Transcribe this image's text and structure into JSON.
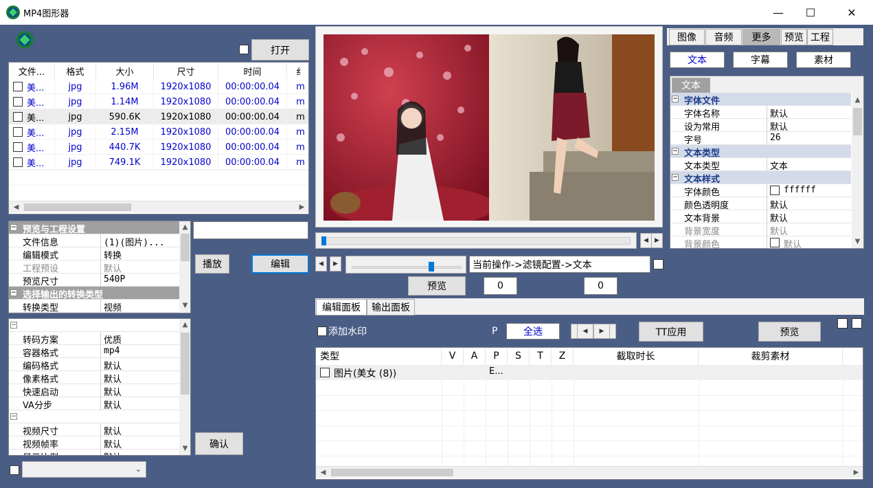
{
  "window": {
    "title": "MP4图形器",
    "minimize": "—",
    "maximize": "☐",
    "close": "✕"
  },
  "left": {
    "open_label": "打开",
    "files": {
      "headers": [
        "文件...",
        "格式",
        "大小",
        "尺寸",
        "时间",
        "纟"
      ],
      "rows": [
        {
          "name": "美...",
          "fmt": "jpg",
          "size": "1.96M",
          "dim": "1920x1080",
          "time": "00:00:00.04",
          "more": "m",
          "sel": false
        },
        {
          "name": "美...",
          "fmt": "jpg",
          "size": "1.14M",
          "dim": "1920x1080",
          "time": "00:00:00.04",
          "more": "m",
          "sel": false
        },
        {
          "name": "美...",
          "fmt": "jpg",
          "size": "590.6K",
          "dim": "1920x1080",
          "time": "00:00:00.04",
          "more": "m",
          "sel": true
        },
        {
          "name": "美...",
          "fmt": "jpg",
          "size": "2.15M",
          "dim": "1920x1080",
          "time": "00:00:00.04",
          "more": "m",
          "sel": false
        },
        {
          "name": "美...",
          "fmt": "jpg",
          "size": "440.7K",
          "dim": "1920x1080",
          "time": "00:00:00.04",
          "more": "m",
          "sel": false
        },
        {
          "name": "美...",
          "fmt": "jpg",
          "size": "749.1K",
          "dim": "1920x1080",
          "time": "00:00:00.04",
          "more": "m",
          "sel": false
        }
      ]
    },
    "preview_settings": {
      "cat1": "预览与工程设置",
      "items1": [
        {
          "k": "文件信息",
          "v": "(1)(图片)...",
          "gray": false
        },
        {
          "k": "编辑模式",
          "v": "转换",
          "gray": false
        },
        {
          "k": "工程预设",
          "v": "默认",
          "gray": true
        },
        {
          "k": "预览尺寸",
          "v": "540P",
          "gray": false
        }
      ],
      "cat2": "选择输出的转换类型",
      "items2": [
        {
          "k": "转换类型",
          "v": "视频"
        }
      ]
    },
    "play_label": "播放",
    "edit_label": "编辑",
    "output_settings": {
      "items1": [
        {
          "k": "转码方案",
          "v": "优质"
        },
        {
          "k": "容器格式",
          "v": "mp4"
        },
        {
          "k": "编码格式",
          "v": "默认"
        },
        {
          "k": "像素格式",
          "v": "默认"
        },
        {
          "k": "快速启动",
          "v": "默认"
        },
        {
          "k": "VA分步",
          "v": "默认"
        }
      ],
      "items2": [
        {
          "k": "视频尺寸",
          "v": "默认"
        },
        {
          "k": "视频帧率",
          "v": "默认"
        },
        {
          "k": "显示比例",
          "v": "默认"
        }
      ]
    },
    "confirm_label": "确认"
  },
  "center": {
    "operation_text": "当前操作->滤镜配置->文本",
    "preview_label": "预览",
    "num1": "0",
    "num2": "0",
    "tabs": [
      "编辑面板",
      "输出面板"
    ],
    "watermark_label": "添加水印",
    "p_label": "P",
    "select_all": "全选",
    "tt_apply": "TT应用",
    "preview2": "预览",
    "table": {
      "headers": [
        "类型",
        "V",
        "A",
        "P",
        "S",
        "T",
        "Z",
        "截取时长",
        "裁剪素材"
      ],
      "row": {
        "type": "图片(美女 (8))",
        "p": "E..."
      }
    }
  },
  "right": {
    "tabs": [
      "图像",
      "音频",
      "更多",
      "预览",
      "工程"
    ],
    "subtabs": [
      "文本",
      "字幕",
      "素材"
    ],
    "text_tab": "文本",
    "props": [
      {
        "cat": "字体文件"
      },
      {
        "k": "字体名称",
        "v": "默认"
      },
      {
        "k": "设为常用",
        "v": "默认"
      },
      {
        "k": "字号",
        "v": "26"
      },
      {
        "cat": "文本类型"
      },
      {
        "k": "文本类型",
        "v": "文本"
      },
      {
        "cat": "文本样式"
      },
      {
        "k": "字体颜色",
        "v": "ffffff",
        "swatch": true
      },
      {
        "k": "颜色透明度",
        "v": "默认"
      },
      {
        "k": "文本背景",
        "v": "默认"
      },
      {
        "k": "背景宽度",
        "v": "默认",
        "gray": true
      },
      {
        "k": "背景颜色",
        "v": "默认",
        "swatch": true,
        "gray": true
      }
    ]
  },
  "colors": {
    "bg": "#4a5d85",
    "accent": "#0078d7"
  }
}
